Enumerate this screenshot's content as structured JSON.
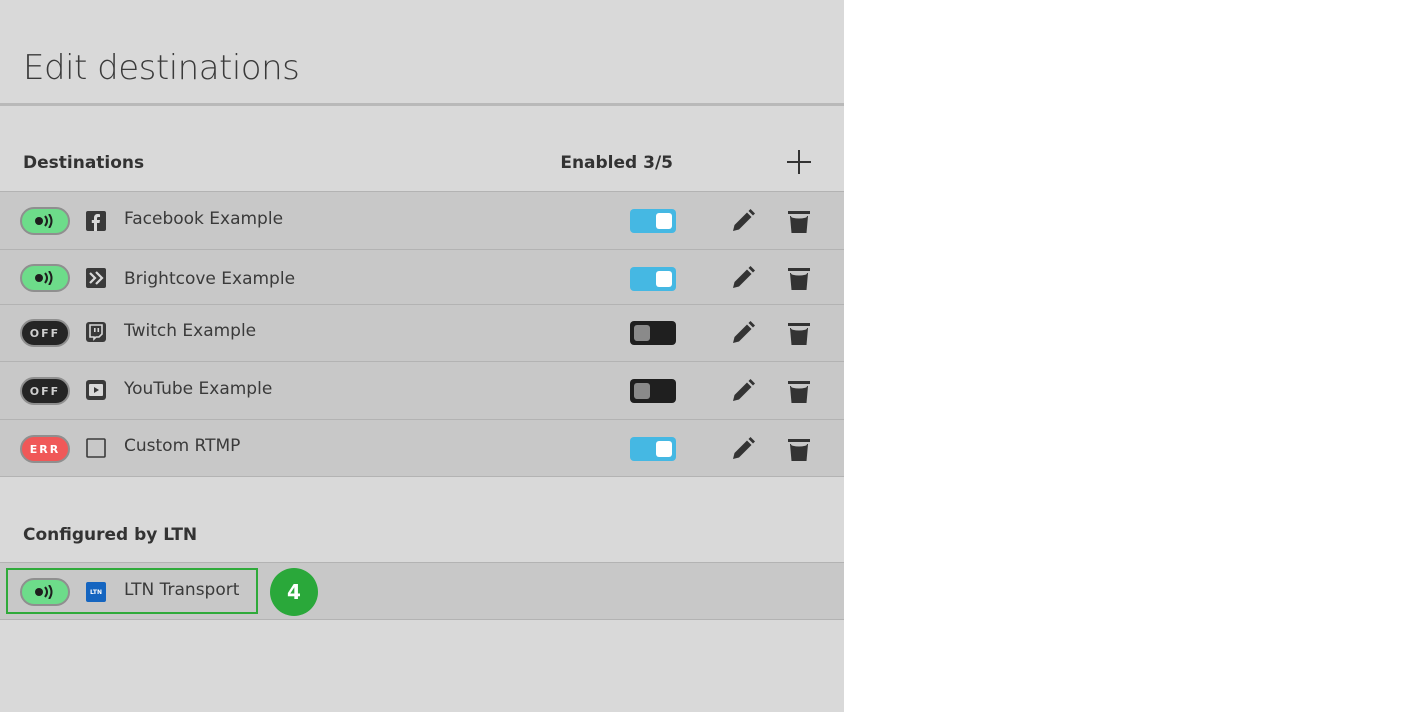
{
  "page": {
    "title": "Edit destinations"
  },
  "destinations": {
    "label": "Destinations",
    "enabled_count": "Enabled 3/5",
    "add_icon": "plus-icon",
    "rows": [
      {
        "status": "live",
        "status_text": "",
        "service_icon": "facebook-icon",
        "label": "Facebook Example",
        "enabled": true
      },
      {
        "status": "live",
        "status_text": "",
        "service_icon": "brightcove-icon",
        "label": "Brightcove Example",
        "enabled": true
      },
      {
        "status": "off",
        "status_text": "OFF",
        "service_icon": "twitch-icon",
        "label": "Twitch Example",
        "enabled": false
      },
      {
        "status": "off",
        "status_text": "OFF",
        "service_icon": "youtube-icon",
        "label": "YouTube Example",
        "enabled": false
      },
      {
        "status": "err",
        "status_text": "ERR",
        "service_icon": "custom-rtmp-icon",
        "label": "Custom RTMP",
        "enabled": true
      }
    ]
  },
  "configured": {
    "label": "Configured by LTN",
    "rows": [
      {
        "status": "live",
        "status_text": "",
        "service_icon": "ltn-icon",
        "service_icon_text": "LTN",
        "label": "LTN Transport"
      }
    ]
  },
  "callout": {
    "number": "4"
  },
  "colors": {
    "panel": "#d9d9d9",
    "row": "#c8c8c8",
    "live": "#6ddc8a",
    "off": "#252525",
    "err": "#f05858",
    "toggle_on": "#45b8e3",
    "callout_green": "#2aa83a",
    "ltn_blue": "#1565c0"
  }
}
